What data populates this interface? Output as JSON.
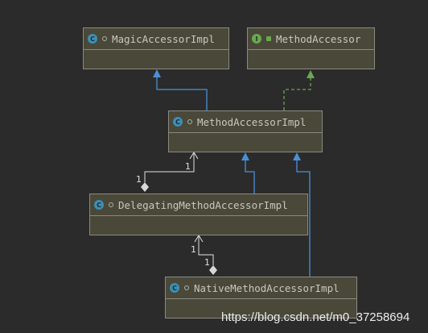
{
  "diagram": {
    "classes": [
      {
        "id": "magic",
        "name": "MagicAccessorImpl",
        "kind": "class",
        "badge": "C"
      },
      {
        "id": "methodaccessor",
        "name": "MethodAccessor",
        "kind": "interface",
        "badge": "I"
      },
      {
        "id": "methodaccessorimpl",
        "name": "MethodAccessorImpl",
        "kind": "class",
        "badge": "C"
      },
      {
        "id": "delegating",
        "name": "DelegatingMethodAccessorImpl",
        "kind": "class",
        "badge": "C"
      },
      {
        "id": "native",
        "name": "NativeMethodAccessorImpl",
        "kind": "class",
        "badge": "C"
      }
    ],
    "multiplicities": {
      "delegating_to_impl_target": "1",
      "delegating_to_impl_source": "1",
      "native_to_delegating_target": "1",
      "native_to_delegating_source": "1"
    }
  },
  "watermark": "https://blog.csdn.net/m0_37258694",
  "colors": {
    "background": "#2b2b2b",
    "class_fill": "#4a4838",
    "inheritance": "#4a8fd8",
    "implementation": "#6aa84f",
    "association": "#e0e0e0"
  }
}
